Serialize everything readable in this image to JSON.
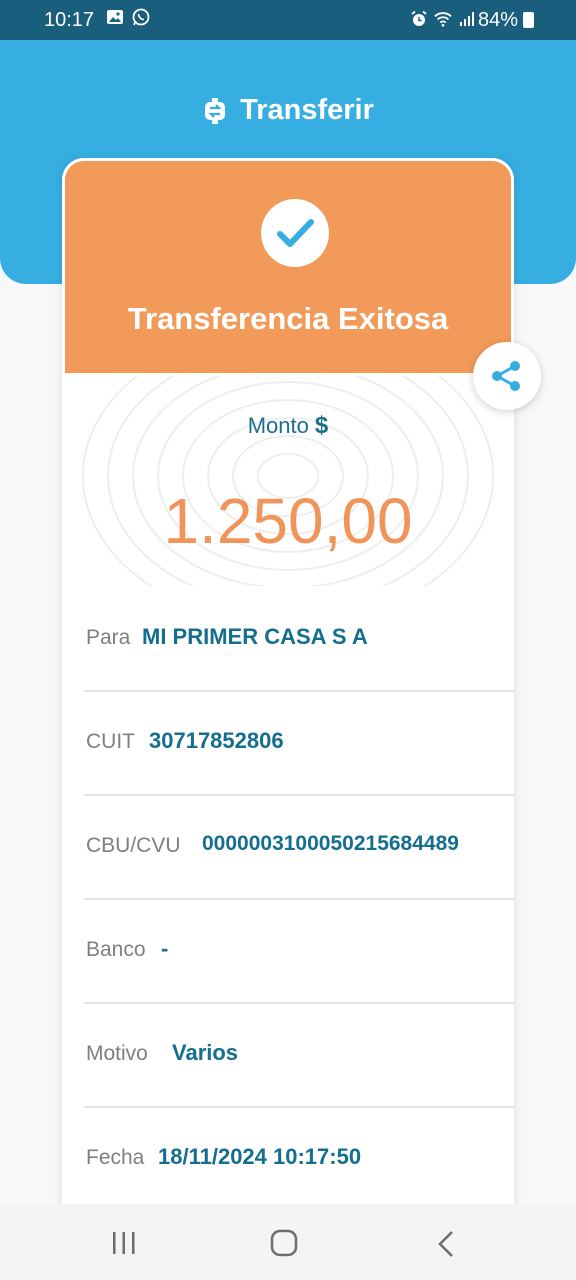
{
  "status_bar": {
    "time": "10:17",
    "battery": "84%"
  },
  "header": {
    "title": "Transferir",
    "icon": "transfer-icon"
  },
  "result": {
    "title": "Transferencia Exitosa",
    "icon": "checkmark-icon"
  },
  "amount": {
    "label": "Monto",
    "currency": "$",
    "value": "1.250,00"
  },
  "details": [
    {
      "label": "Para",
      "value": "MI PRIMER CASA S A"
    },
    {
      "label": "CUIT",
      "value": "30717852806"
    },
    {
      "label": "CBU/CVU",
      "value": "0000003100050215684489"
    },
    {
      "label": "Banco",
      "value": "-"
    },
    {
      "label": "Motivo",
      "value": "Varios"
    },
    {
      "label": "Fecha",
      "value": "18/11/2024 10:17:50"
    }
  ],
  "colors": {
    "header": "#36aee2",
    "status_bar": "#1a5e7e",
    "accent_orange": "#f19a5a",
    "value_teal": "#146e8f"
  }
}
